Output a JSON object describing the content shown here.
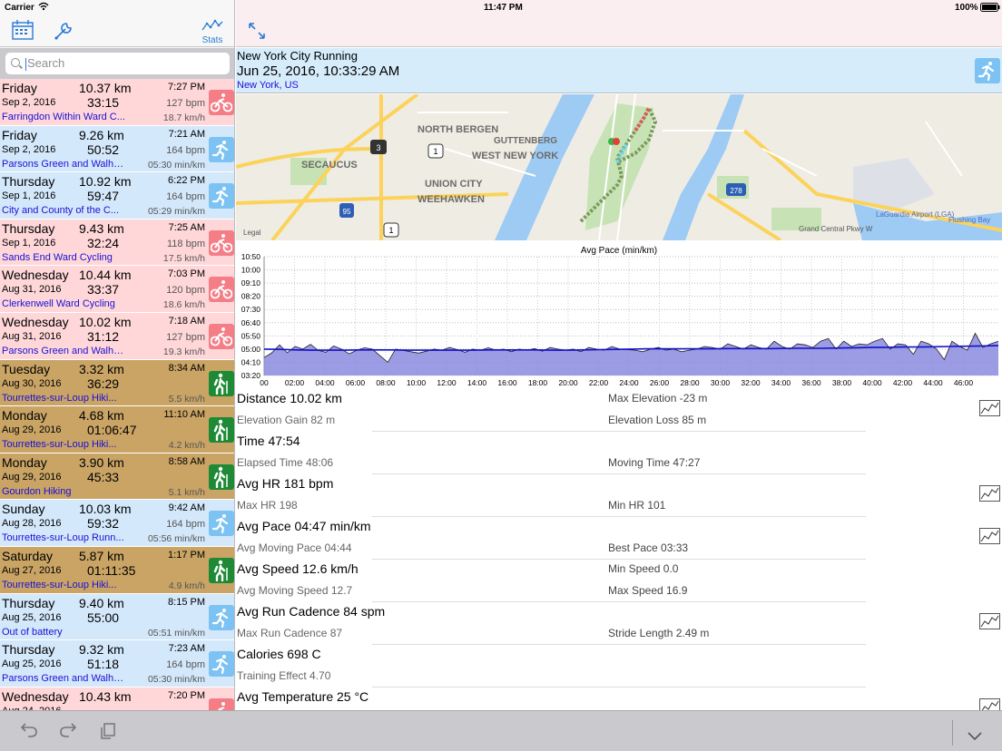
{
  "status": {
    "carrier": "Carrier",
    "time": "11:47 PM",
    "battery": "100%"
  },
  "toolbar": {
    "stats_label": "Stats"
  },
  "search": {
    "placeholder": "Search"
  },
  "activities": [
    {
      "type": "cycling",
      "day": "Friday",
      "distance": "10.37 km",
      "time": "7:27 PM",
      "date": "Sep 2, 2016",
      "duration": "33:15",
      "hr": "127 bpm",
      "location": "Farringdon Within Ward C...",
      "speed": "18.7 km/h"
    },
    {
      "type": "running",
      "day": "Friday",
      "distance": "9.26 km",
      "time": "7:21 AM",
      "date": "Sep 2, 2016",
      "duration": "50:52",
      "hr": "164 bpm",
      "location": "Parsons Green and Walham...",
      "speed": "05:30 min/km"
    },
    {
      "type": "running",
      "day": "Thursday",
      "distance": "10.92 km",
      "time": "6:22 PM",
      "date": "Sep 1, 2016",
      "duration": "59:47",
      "hr": "164 bpm",
      "location": "City and County of the C...",
      "speed": "05:29 min/km"
    },
    {
      "type": "cycling",
      "day": "Thursday",
      "distance": "9.43 km",
      "time": "7:25 AM",
      "date": "Sep 1, 2016",
      "duration": "32:24",
      "hr": "118 bpm",
      "location": "Sands End Ward Cycling",
      "speed": "17.5 km/h"
    },
    {
      "type": "cycling",
      "day": "Wednesday",
      "distance": "10.44 km",
      "time": "7:03 PM",
      "date": "Aug 31, 2016",
      "duration": "33:37",
      "hr": "120 bpm",
      "location": "Clerkenwell Ward Cycling",
      "speed": "18.6 km/h"
    },
    {
      "type": "cycling",
      "day": "Wednesday",
      "distance": "10.02 km",
      "time": "7:18 AM",
      "date": "Aug 31, 2016",
      "duration": "31:12",
      "hr": "127 bpm",
      "location": "Parsons Green and Walham...",
      "speed": "19.3 km/h"
    },
    {
      "type": "hiking",
      "day": "Tuesday",
      "distance": "3.32 km",
      "time": "8:34 AM",
      "date": "Aug 30, 2016",
      "duration": "36:29",
      "hr": "",
      "location": "Tourrettes-sur-Loup Hiki...",
      "speed": "5.5 km/h"
    },
    {
      "type": "hiking",
      "day": "Monday",
      "distance": "4.68 km",
      "time": "11:10 AM",
      "date": "Aug 29, 2016",
      "duration": "01:06:47",
      "hr": "",
      "location": "Tourrettes-sur-Loup Hiki...",
      "speed": "4.2 km/h"
    },
    {
      "type": "hiking",
      "day": "Monday",
      "distance": "3.90 km",
      "time": "8:58 AM",
      "date": "Aug 29, 2016",
      "duration": "45:33",
      "hr": "",
      "location": "Gourdon Hiking",
      "speed": "5.1 km/h"
    },
    {
      "type": "running",
      "day": "Sunday",
      "distance": "10.03 km",
      "time": "9:42 AM",
      "date": "Aug 28, 2016",
      "duration": "59:32",
      "hr": "164 bpm",
      "location": "Tourrettes-sur-Loup Runn...",
      "speed": "05:56 min/km"
    },
    {
      "type": "hiking",
      "day": "Saturday",
      "distance": "5.87 km",
      "time": "1:17 PM",
      "date": "Aug 27, 2016",
      "duration": "01:11:35",
      "hr": "",
      "location": "Tourrettes-sur-Loup Hiki...",
      "speed": "4.9 km/h"
    },
    {
      "type": "running",
      "day": "Thursday",
      "distance": "9.40 km",
      "time": "8:15 PM",
      "date": "Aug 25, 2016",
      "duration": "55:00",
      "hr": "",
      "location": "Out of battery",
      "speed": "05:51 min/km"
    },
    {
      "type": "running",
      "day": "Thursday",
      "distance": "9.32 km",
      "time": "7:23 AM",
      "date": "Aug 25, 2016",
      "duration": "51:18",
      "hr": "164 bpm",
      "location": "Parsons Green and Walham...",
      "speed": "05:30 min/km"
    },
    {
      "type": "cycling",
      "day": "Wednesday",
      "distance": "10.43 km",
      "time": "7:20 PM",
      "date": "Aug 24, 2016",
      "duration": "",
      "hr": "",
      "location": "",
      "speed": ""
    }
  ],
  "detail": {
    "title": "New York City Running",
    "datetime": "Jun 25, 2016, 10:33:29 AM",
    "location": "New York, US"
  },
  "map_labels": {
    "north_bergen": "NORTH BERGEN",
    "guttenberg": "GUTTENBERG",
    "west_new_york": "WEST NEW YORK",
    "secaucus": "SECAUCUS",
    "union_city": "UNION CITY",
    "weehawken": "WEEHAWKEN",
    "laguardia": "LaGuardia Airport (LGA)",
    "flushing_bay": "Flushing Bay",
    "grand_central": "Grand Central Pkwy W",
    "legal": "Legal",
    "r3": "3",
    "r1": "1",
    "r95": "95",
    "r1b": "1",
    "r278": "278"
  },
  "chart_data": {
    "type": "area",
    "title": "Avg Pace (min/km)",
    "y_ticks": [
      "10:50",
      "10:00",
      "09:10",
      "08:20",
      "07:30",
      "06:40",
      "05:50",
      "05:00",
      "04:10",
      "03:20"
    ],
    "x_ticks": [
      "00",
      "02:00",
      "04:00",
      "06:00",
      "08:00",
      "10:00",
      "12:00",
      "14:00",
      "16:00",
      "18:00",
      "20:00",
      "22:00",
      "24:00",
      "26:00",
      "28:00",
      "30:00",
      "32:00",
      "34:00",
      "36:00",
      "38:00",
      "40:00",
      "42:00",
      "44:00",
      "46:00"
    ],
    "ylim_seconds": [
      200,
      650
    ],
    "series": [
      {
        "values": [
          268,
          286,
          316,
          286,
          310,
          300,
          318,
          295,
          288,
          312,
          300,
          282,
          296,
          305,
          300,
          275,
          250,
          300,
          295,
          290,
          285,
          292,
          300,
          296,
          306,
          298,
          288,
          300,
          295,
          305,
          296,
          300,
          290,
          300,
          296,
          302,
          292,
          306,
          300,
          296,
          300,
          290,
          306,
          300,
          296,
          310,
          300,
          298,
          296,
          290,
          300,
          306,
          296,
          300,
          290,
          296,
          300,
          310,
          306,
          300,
          320,
          310,
          300,
          316,
          306,
          300,
          330,
          310,
          300,
          320,
          316,
          306,
          330,
          340,
          300,
          330,
          310,
          320,
          316,
          330,
          340,
          300,
          320,
          316,
          280,
          330,
          320,
          300,
          260,
          330,
          310,
          296,
          360,
          306,
          320,
          330
        ]
      },
      {
        "values": [
          300,
          299,
          297,
          296,
          296,
          296,
          297,
          297,
          297,
          296,
          296,
          296,
          296,
          296,
          297,
          297,
          297,
          297,
          296,
          296,
          297,
          298,
          299,
          300,
          301,
          301,
          301,
          301,
          301,
          302,
          302,
          302,
          302,
          303,
          303,
          303,
          304,
          305,
          306,
          307,
          308,
          308,
          309,
          310,
          311,
          312,
          313
        ]
      }
    ]
  },
  "stats": [
    {
      "big": "Distance 10.02 km",
      "rbig": "Max Elevation -23 m",
      "l2": "Elevation Gain 82 m",
      "r2": "Elevation Loss 85 m",
      "graph": true
    },
    {
      "big": "Time 47:54",
      "rbig": "",
      "l2": "Elapsed Time 48:06",
      "r2": "Moving Time 47:27",
      "graph": false
    },
    {
      "big": "Avg HR 181 bpm",
      "rbig": "",
      "l2": "Max HR 198",
      "r2": "Min HR 101",
      "graph": true
    },
    {
      "big": "Avg Pace 04:47 min/km",
      "rbig": "",
      "l2": "Avg Moving Pace 04:44",
      "r2": "Best Pace 03:33",
      "graph": true
    },
    {
      "big": "Avg Speed 12.6 km/h",
      "rbig": "Min Speed 0.0",
      "l2": "Avg Moving Speed 12.7",
      "r2": "Max Speed 16.9",
      "graph": false
    },
    {
      "big": "Avg Run Cadence 84 spm",
      "rbig": "",
      "l2": "Max Run Cadence 87",
      "r2": "Stride Length 2.49 m",
      "graph": true
    },
    {
      "big": "Calories 698 C",
      "rbig": "",
      "l2": "Training Effect 4.70",
      "r2": "",
      "graph": false
    },
    {
      "big": "Avg Temperature 25 °C",
      "rbig": "",
      "l2": "",
      "r2": "",
      "graph": true
    }
  ]
}
